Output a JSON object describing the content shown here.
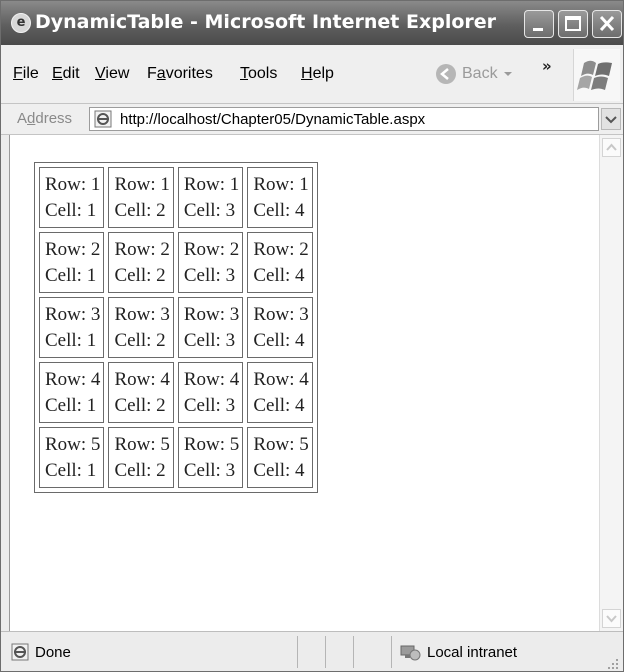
{
  "window": {
    "title": "DynamicTable - Microsoft Internet Explorer"
  },
  "menu": {
    "items": [
      {
        "label": "File",
        "accel": "F",
        "rest": "ile"
      },
      {
        "label": "Edit",
        "accel": "E",
        "rest": "dit"
      },
      {
        "label": "View",
        "accel": "V",
        "rest": "iew"
      },
      {
        "label": "Favorites",
        "pre": "F",
        "accel": "a",
        "rest": "vorites"
      },
      {
        "label": "Tools",
        "accel": "T",
        "rest": "ools"
      },
      {
        "label": "Help",
        "accel": "H",
        "rest": "elp"
      }
    ]
  },
  "toolbar": {
    "back_label": "Back",
    "overflow_glyph": "»"
  },
  "address": {
    "label": "Address",
    "accel": "d",
    "url": "http://localhost/Chapter05/DynamicTable.aspx"
  },
  "table": {
    "rows": [
      [
        {
          "row": "Row: 1",
          "cell": "Cell: 1"
        },
        {
          "row": "Row: 1",
          "cell": "Cell: 2"
        },
        {
          "row": "Row: 1",
          "cell": "Cell: 3"
        },
        {
          "row": "Row: 1",
          "cell": "Cell: 4"
        }
      ],
      [
        {
          "row": "Row: 2",
          "cell": "Cell: 1"
        },
        {
          "row": "Row: 2",
          "cell": "Cell: 2"
        },
        {
          "row": "Row: 2",
          "cell": "Cell: 3"
        },
        {
          "row": "Row: 2",
          "cell": "Cell: 4"
        }
      ],
      [
        {
          "row": "Row: 3",
          "cell": "Cell: 1"
        },
        {
          "row": "Row: 3",
          "cell": "Cell: 2"
        },
        {
          "row": "Row: 3",
          "cell": "Cell: 3"
        },
        {
          "row": "Row: 3",
          "cell": "Cell: 4"
        }
      ],
      [
        {
          "row": "Row: 4",
          "cell": "Cell: 1"
        },
        {
          "row": "Row: 4",
          "cell": "Cell: 2"
        },
        {
          "row": "Row: 4",
          "cell": "Cell: 3"
        },
        {
          "row": "Row: 4",
          "cell": "Cell: 4"
        }
      ],
      [
        {
          "row": "Row: 5",
          "cell": "Cell: 1"
        },
        {
          "row": "Row: 5",
          "cell": "Cell: 2"
        },
        {
          "row": "Row: 5",
          "cell": "Cell: 3"
        },
        {
          "row": "Row: 5",
          "cell": "Cell: 4"
        }
      ]
    ]
  },
  "status": {
    "text": "Done",
    "zone": "Local intranet"
  },
  "icons": {
    "app": "ie-icon",
    "page": "page-icon",
    "zone": "local-intranet-icon"
  }
}
